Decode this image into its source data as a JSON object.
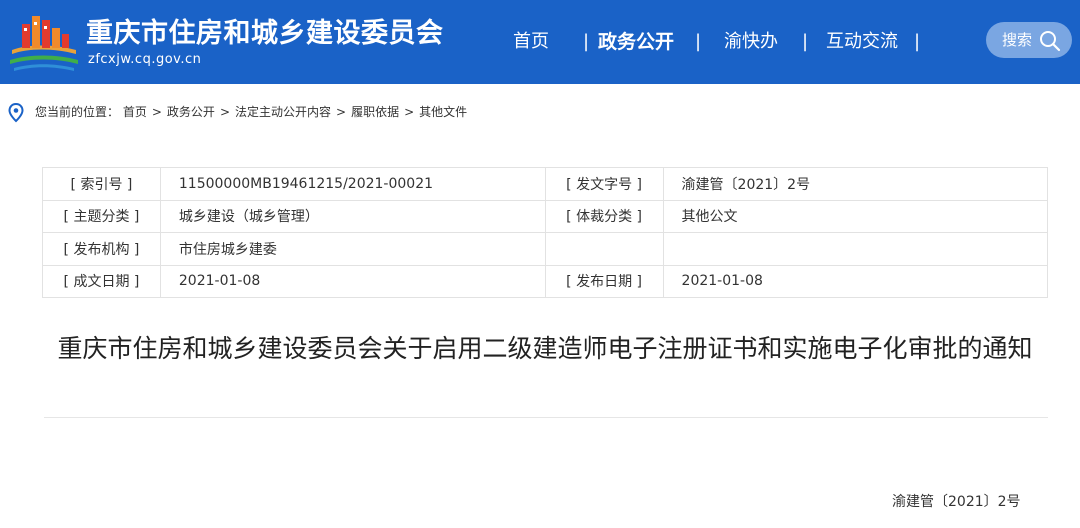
{
  "header": {
    "site_title": "重庆市住房和城乡建设委员会",
    "site_domain": "zfcxjw.cq.gov.cn",
    "logo_icon": "city-emblem-icon",
    "nav": [
      {
        "label": "首页",
        "active": false
      },
      {
        "label": "政务公开",
        "active": true
      },
      {
        "label": "渝快办",
        "active": false
      },
      {
        "label": "互动交流",
        "active": false
      }
    ],
    "separator": "|",
    "search_label": "搜索",
    "colors": {
      "header_bg": "#1a62c7",
      "search_bg": "#7aa6e2"
    }
  },
  "breadcrumb": {
    "prefix": "您当前的位置：",
    "items": [
      "首页",
      "政务公开",
      "法定主动公开内容",
      "履职依据",
      "其他文件"
    ],
    "arrow": ">"
  },
  "meta_table": {
    "rows": [
      {
        "k1": "[ 索引号 ]",
        "v1": "11500000MB19461215/2021-00021",
        "k2": "[ 发文字号 ]",
        "v2": "渝建管〔2021〕2号"
      },
      {
        "k1": "[ 主题分类 ]",
        "v1": "城乡建设（城乡管理）",
        "k2": "[ 体裁分类 ]",
        "v2": "其他公文"
      },
      {
        "k1": "[ 发布机构 ]",
        "v1": "市住房城乡建委",
        "k2": "",
        "v2": ""
      },
      {
        "k1": "[ 成文日期 ]",
        "v1": "2021-01-08",
        "k2": "[ 发布日期 ]",
        "v2": "2021-01-08"
      }
    ]
  },
  "document": {
    "title": "重庆市住房和城乡建设委员会关于启用二级建造师电子注册证书和实施电子化审批的通知",
    "number": "渝建管〔2021〕2号"
  }
}
